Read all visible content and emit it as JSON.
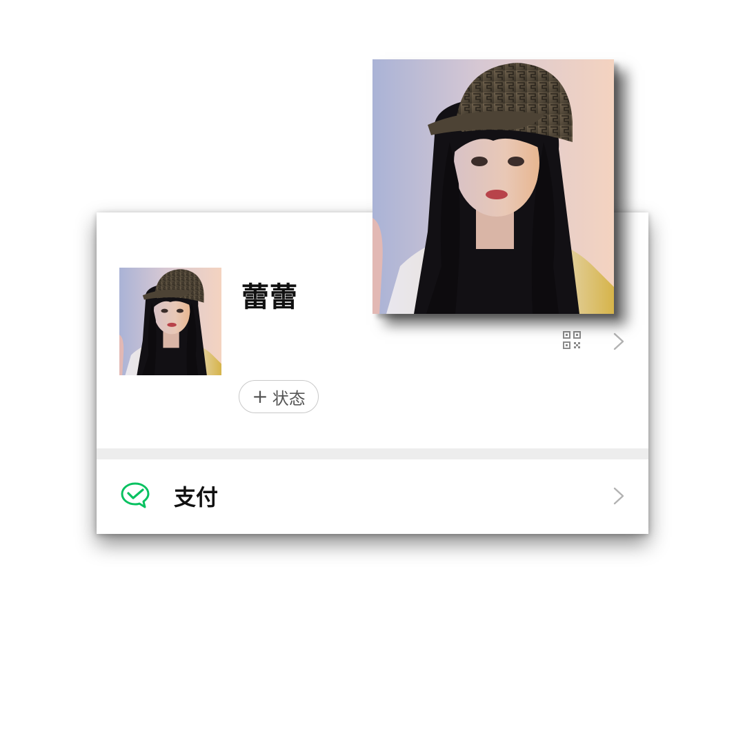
{
  "profile": {
    "nickname": "蕾蕾",
    "status_button": {
      "plus": "+",
      "label": "状态"
    },
    "qr_icon": "qr-code-icon",
    "chevron_icon": "chevron-right-icon",
    "avatar": "portrait-photo"
  },
  "menu": {
    "pay": {
      "label": "支付",
      "icon": "wechat-pay-icon",
      "icon_color": "#07c160"
    }
  },
  "colors": {
    "background": "#ffffff",
    "separator": "#ededed",
    "text_primary": "#111111",
    "text_secondary": "#555555",
    "chevron": "#b2b2b2",
    "accent": "#07c160"
  }
}
